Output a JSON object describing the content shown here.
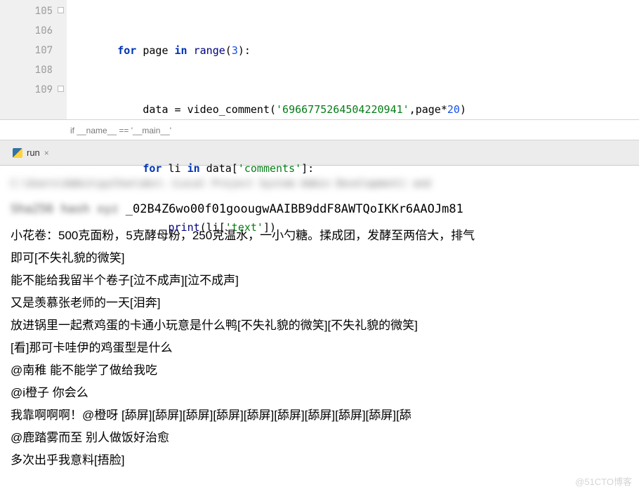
{
  "editor": {
    "lines": [
      {
        "num": "105"
      },
      {
        "num": "106"
      },
      {
        "num": "107"
      },
      {
        "num": "108"
      },
      {
        "num": "109"
      }
    ],
    "code": {
      "l105": {
        "kw1": "for",
        "id1": " page ",
        "kw2": "in",
        "fn": " range",
        "p1": "(",
        "n1": "3",
        "p2": "):"
      },
      "l106": {
        "id1": "data = video_comment(",
        "s1": "'6966775264504220941'",
        "p1": ",page*",
        "n1": "20",
        "p2": ")"
      },
      "l107": {
        "kw1": "for",
        "id1": " li ",
        "kw2": "in",
        "id2": " data[",
        "s1": "'comments'",
        "p1": "]:"
      },
      "l108": {
        "fn": "print",
        "p1": "(li[",
        "s1": "'text'",
        "p2": "])"
      }
    }
  },
  "breadcrumb": {
    "text": "if __name__ == '__main__'"
  },
  "tab": {
    "label": "run",
    "close": "×"
  },
  "console": {
    "blur1": "C:\\Users\\Admin\\python\\dev\\ (Local Project System Admin Development) and",
    "hash_blur": "Sha256 hash xyz ",
    "hash_clear": "_02B4Z6wo00f01gooug­wAAIBB9ddF8AWTQoIKKr6AAOJm81",
    "lines": [
      "小花卷：500克面粉，5克酵母粉，250克温水，一小勺糖。揉成团，发酵至两倍大，排气",
      "即可[不失礼貌的微笑]",
      "能不能给我留半个卷子[泣不成声][泣不成声]",
      "又是羡慕张老师的一天[泪奔]",
      "放进锅里一起煮鸡蛋的卡通小玩意是什么鸭[不失礼貌的微笑][不失礼貌的微笑]",
      "[看]那可卡哇伊的鸡蛋型是什么",
      "@南稚  能不能学了做给我吃",
      "@i橙子  你会么",
      "我靠啊啊啊！@橙呀  [舔屏][舔屏][舔屏][舔屏][舔屏][舔屏][舔屏][舔屏][舔屏][舔",
      "@鹿踏雾而至  别人做饭好治愈",
      "多次出乎我意料[捂脸]"
    ]
  },
  "watermark": "@51CTO博客"
}
